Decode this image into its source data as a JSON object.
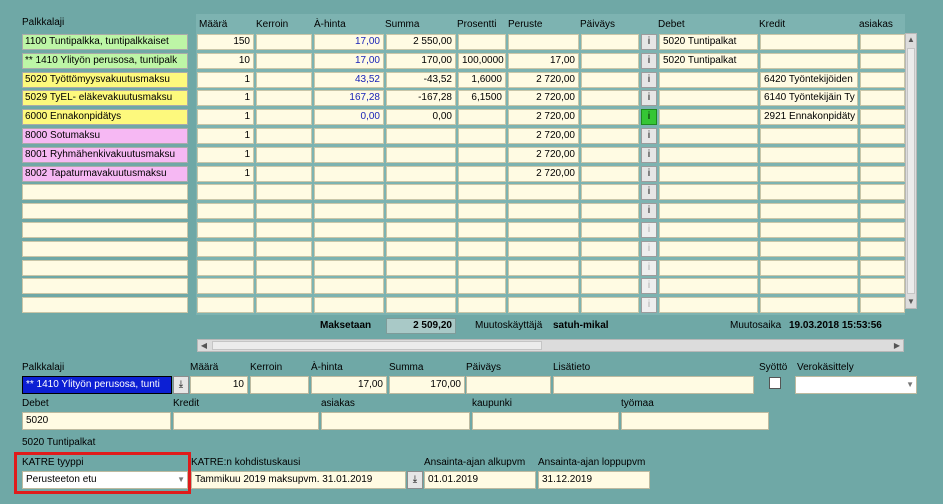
{
  "grid": {
    "headers": {
      "palkkalaji": "Palkkalaji",
      "maara": "Määrä",
      "kerroin": "Kerroin",
      "ahinta": "À-hinta",
      "summa": "Summa",
      "prosentti": "Prosentti",
      "peruste": "Peruste",
      "paivays": "Päiväys",
      "debet": "Debet",
      "kredit": "Kredit",
      "asiakas": "asiakas"
    },
    "rows": [
      {
        "kind": "1100 Tuntipalkka, tuntipalkkaiset",
        "color": "#bdf5a6",
        "maara": "150",
        "kerroin": "",
        "ahinta": "17,00",
        "summa": "2 550,00",
        "prosentti": "",
        "peruste": "",
        "paivays": "",
        "info": "i",
        "debet": "5020 Tuntipalkat",
        "kredit": "",
        "asiakas": ""
      },
      {
        "kind": "** 1410 Ylityön perusosa, tuntipalk",
        "color": "#bdf5a6",
        "maara": "10",
        "kerroin": "",
        "ahinta": "17,00",
        "summa": "170,00",
        "prosentti": "100,0000",
        "peruste": "17,00",
        "paivays": "",
        "info": "i",
        "debet": "5020 Tuntipalkat",
        "kredit": "",
        "asiakas": ""
      },
      {
        "kind": "5020 Työttömyysvakuutusmaksu",
        "color": "#fdf97d",
        "maara": "1",
        "kerroin": "",
        "ahinta": "43,52",
        "summa": "-43,52",
        "prosentti": "1,6000",
        "peruste": "2 720,00",
        "paivays": "",
        "info": "i",
        "debet": "",
        "kredit": "6420 Työntekijöiden",
        "asiakas": ""
      },
      {
        "kind": "5029 TyEL- eläkevakuutusmaksu",
        "color": "#fdf97d",
        "maara": "1",
        "kerroin": "",
        "ahinta": "167,28",
        "summa": "-167,28",
        "prosentti": "6,1500",
        "peruste": "2 720,00",
        "paivays": "",
        "info": "i",
        "debet": "",
        "kredit": "6140 Työntekijäin Ty",
        "asiakas": ""
      },
      {
        "kind": "6000 Ennakonpidätys",
        "color": "#fdf97d",
        "maara": "1",
        "kerroin": "",
        "ahinta": "0,00",
        "summa": "0,00",
        "prosentti": "",
        "peruste": "2 720,00",
        "paivays": "",
        "info": "i",
        "debet": "",
        "kredit": "2921 Ennakonpidäty",
        "asiakas": ""
      },
      {
        "kind": "8000 Sotumaksu",
        "color": "#f6b8f3",
        "maara": "1",
        "kerroin": "",
        "ahinta": "",
        "summa": "",
        "prosentti": "",
        "peruste": "2 720,00",
        "paivays": "",
        "info": "i",
        "debet": "",
        "kredit": "",
        "asiakas": ""
      },
      {
        "kind": "8001 Ryhmähenkivakuutusmaksu",
        "color": "#f6b8f3",
        "maara": "1",
        "kerroin": "",
        "ahinta": "",
        "summa": "",
        "prosentti": "",
        "peruste": "2 720,00",
        "paivays": "",
        "info": "i",
        "debet": "",
        "kredit": "",
        "asiakas": ""
      },
      {
        "kind": "8002 Tapaturmavakuutusmaksu",
        "color": "#f6b8f3",
        "maara": "1",
        "kerroin": "",
        "ahinta": "",
        "summa": "",
        "prosentti": "",
        "peruste": "2 720,00",
        "paivays": "",
        "info": "i",
        "debet": "",
        "kredit": "",
        "asiakas": ""
      }
    ],
    "info_label": "i"
  },
  "summary": {
    "maksetaan_label": "Maksetaan",
    "maksetaan_value": "2 509,20",
    "muutoskayttaja_label": "Muutoskäyttäjä",
    "muutoskayttaja_value": "satuh-mikal",
    "muutosaika_label": "Muutosaika",
    "muutosaika_value": "19.03.2018 15:53:56"
  },
  "detail": {
    "palkkalaji_label": "Palkkalaji",
    "palkkalaji_value": "** 1410 Ylityön perusosa, tunti",
    "maara_label": "Määrä",
    "maara_value": "10",
    "kerroin_label": "Kerroin",
    "kerroin_value": "",
    "ahinta_label": "À-hinta",
    "ahinta_value": "17,00",
    "summa_label": "Summa",
    "summa_value": "170,00",
    "paivays_label": "Päiväys",
    "paivays_value": "",
    "lisatieto_label": "Lisätieto",
    "lisatieto_value": "",
    "syotto_label": "Syöttö",
    "verokasittely_label": "Verokäsittely",
    "verokasittely_value": "",
    "debet_label": "Debet",
    "debet_value": "5020",
    "kredit_label": "Kredit",
    "kredit_value": "",
    "asiakas_label": "asiakas",
    "asiakas_value": "",
    "kaupunki_label": "kaupunki",
    "kaupunki_value": "",
    "tyomaa_label": "työmaa",
    "tyomaa_value": "",
    "debet_name": "5020 Tuntipalkat",
    "katre_tyyppi_label": "KATRE tyyppi",
    "katre_tyyppi_value": "Perusteeton etu",
    "katre_kausi_label": "KATRE:n kohdistuskausi",
    "katre_kausi_value": "Tammikuu 2019 maksupvm. 31.01.2019",
    "alkupvm_label": "Ansainta-ajan alkupvm",
    "alkupvm_value": "01.01.2019",
    "loppupvm_label": "Ansainta-ajan loppupvm",
    "loppupvm_value": "31.12.2019"
  },
  "colors": {
    "background": "#6fa8a6",
    "highlight_box": "#e01b1b",
    "selected_field": "#0c1fd4"
  }
}
